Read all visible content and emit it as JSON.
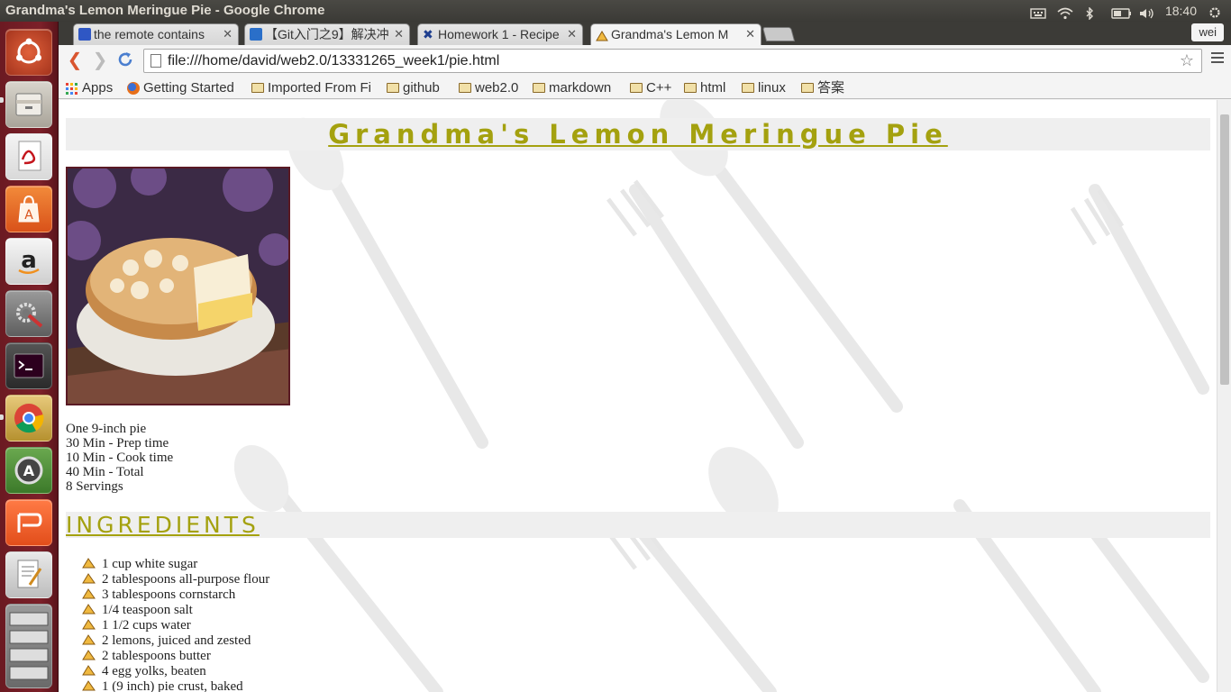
{
  "window": {
    "title": "Grandma's Lemon Meringue Pie - Google Chrome"
  },
  "tray": {
    "time": "18:40",
    "icons": [
      "keyboard-icon",
      "wifi-icon",
      "bluetooth-icon",
      "battery-icon",
      "volume-icon",
      "gear-icon"
    ]
  },
  "launcher": {
    "items": [
      "ubuntu-dash-icon",
      "files-icon",
      "document-viewer-icon",
      "software-center-icon",
      "amazon-icon",
      "system-settings-icon",
      "terminal-icon",
      "chrome-icon",
      "software-updater-icon",
      "wps-presentation-icon",
      "text-editor-icon",
      "workspace-switcher-icon"
    ]
  },
  "tabs": [
    {
      "label": "the remote contains",
      "favicon": "paw-icon",
      "active": false
    },
    {
      "label": "【Git入门之9】解决冲",
      "favicon": "reader-icon",
      "active": false
    },
    {
      "label": "Homework 1 - Recipe",
      "favicon": "homework-icon",
      "active": false
    },
    {
      "label": "Grandma's Lemon M",
      "favicon": "pie-icon",
      "active": true
    }
  ],
  "profile": "wei",
  "omnibox": {
    "url": "file:///home/david/web2.0/13331265_week1/pie.html"
  },
  "bookmarks": [
    {
      "label": "Apps",
      "icon": "apps-icon"
    },
    {
      "label": "Getting Started",
      "icon": "firefox-icon"
    },
    {
      "label": "Imported From Fi",
      "icon": "folder-icon"
    },
    {
      "label": "github",
      "icon": "folder-icon"
    },
    {
      "label": "web2.0",
      "icon": "folder-icon"
    },
    {
      "label": "markdown",
      "icon": "folder-icon"
    },
    {
      "label": "C++",
      "icon": "folder-icon"
    },
    {
      "label": "html",
      "icon": "folder-icon"
    },
    {
      "label": "linux",
      "icon": "folder-icon"
    },
    {
      "label": "答案",
      "icon": "folder-icon"
    }
  ],
  "page": {
    "heading": "Grandma's Lemon Meringue Pie",
    "stats": [
      "One 9-inch pie",
      "30 Min - Prep time",
      "10 Min - Cook time",
      "40 Min - Total",
      "8 Servings"
    ],
    "ingredients_heading": "INGREDIENTS",
    "ingredients": [
      "1 cup white sugar",
      "2 tablespoons all-purpose flour",
      "3 tablespoons cornstarch",
      "1/4 teaspoon salt",
      "1 1/2 cups water",
      "2 lemons, juiced and zested",
      "2 tablespoons butter",
      "4 egg yolks, beaten",
      "1 (9 inch) pie crust, baked"
    ],
    "colors": {
      "heading": "#a4a10f",
      "heading_bar": "#efefef",
      "launcher": "#7c2029"
    }
  }
}
